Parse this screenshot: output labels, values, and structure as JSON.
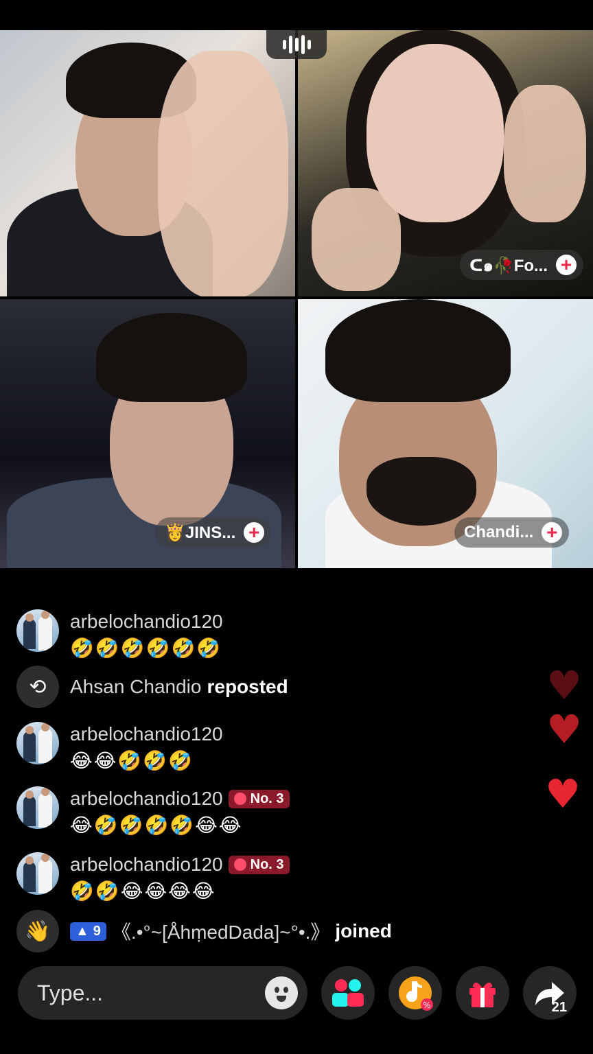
{
  "grid": {
    "tiles": [
      {
        "name": ""
      },
      {
        "name": "ᑕ๑🥀Fo..."
      },
      {
        "name": "👸JINS..."
      },
      {
        "name": "Chandi..."
      }
    ]
  },
  "chat": {
    "messages": [
      {
        "user": "arbelochandio120",
        "text": "🤣🤣🤣🤣🤣🤣",
        "badge": ""
      },
      {
        "system_user": "Ahsan Chandio",
        "system_action": "reposted"
      },
      {
        "user": "arbelochandio120",
        "text": "😂😂🤣🤣🤣",
        "badge": ""
      },
      {
        "user": "arbelochandio120",
        "text": "😂🤣🤣🤣🤣😂😂",
        "badge": "No. 3"
      },
      {
        "user": "arbelochandio120",
        "text": "🤣🤣😂😂😂😂",
        "badge": "No. 3"
      }
    ],
    "join": {
      "level": "9",
      "user": "《.•°~[ÅhṃedDada]~°•.》",
      "action": "joined"
    }
  },
  "input": {
    "placeholder": "Type..."
  },
  "share": {
    "count": "21"
  },
  "colors": {
    "accent": "#fe2c55",
    "heart": "#e8262f",
    "badge": "#8a1a2a",
    "level": "#2c5fd8"
  }
}
